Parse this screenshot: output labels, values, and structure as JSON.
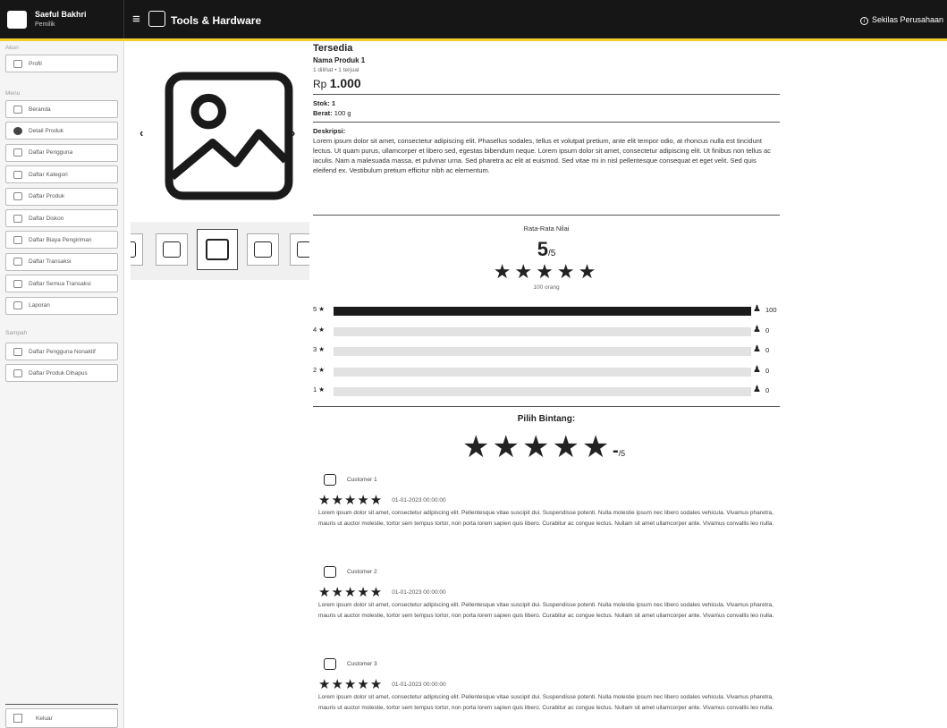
{
  "user": {
    "name": "Saeful Bakhri",
    "role": "Pemilik"
  },
  "header": {
    "category_title": "Tools & Hardware",
    "about_label": "Sekilas Perusahaan"
  },
  "sidebar": {
    "section_account": "Akun",
    "profile": "Profil",
    "section_menu": "Menu",
    "menu": [
      "Beranda",
      "Detail Produk",
      "Daftar Pengguna",
      "Daftar Kategori",
      "Daftar Produk",
      "Daftar Diskon",
      "Daftar Biaya Pengiriman",
      "Daftar Transaksi",
      "Daftar Semua Transaksi",
      "Laporan"
    ],
    "active_index": 1,
    "section_trash": "Sampah",
    "trash": [
      "Daftar Pengguna Nonaktif",
      "Daftar Produk Dihapus"
    ],
    "logout": "Keluar"
  },
  "product": {
    "status": "Tersedia",
    "name": "Nama Produk 1",
    "stats": "1 dilihat • 1 terjual",
    "currency": "Rp",
    "price": "1.000",
    "stock_label": "Stok:",
    "stock": "1",
    "weight_label": "Berat:",
    "weight": "100 g",
    "desc_label": "Deskripsi:",
    "description": "Lorem ipsum dolor sit amet, consectetur adipiscing elit. Phasellus sodales, tellus et volutpat pretium, ante elit tempor odio, at rhoncus nulla est tincidunt lectus. Ut quam purus, ullamcorper et libero sed, egestas bibendum neque. Lorem ipsum dolor sit amet, consectetur adipiscing elit. Ut finibus non tellus ac iaculis. Nam a malesuada massa, et pulvinar urna. Sed pharetra ac elit at euismod. Sed vitae mi in nisl pellentesque consequat et eget velit. Sed quis eleifend ex. Vestibulum pretium efficitur nibh ac elementum."
  },
  "gallery": {
    "prev": "‹",
    "next": "›"
  },
  "rating": {
    "label": "Rata-Rata Nilai",
    "value": "5",
    "max": "/5",
    "stars": "★★★★★",
    "count": "100 orang",
    "bars": [
      {
        "label": "5 ★",
        "count": "100",
        "fraction": 1
      },
      {
        "label": "4 ★",
        "count": "0",
        "fraction": 0
      },
      {
        "label": "3 ★",
        "count": "0",
        "fraction": 0
      },
      {
        "label": "2 ★",
        "count": "0",
        "fraction": 0
      },
      {
        "label": "1 ★",
        "count": "0",
        "fraction": 0
      }
    ]
  },
  "pick": {
    "label": "Pilih Bintang:",
    "stars": "★★★★★",
    "value": "-",
    "max": "/5"
  },
  "reviews": [
    {
      "name": "Customer 1",
      "stars": "★★★★★",
      "date": "01-01-2023 00:00:00",
      "text": "Lorem ipsum dolor sit amet, consectetur adipiscing elit. Pellentesque vitae suscipit dui. Suspendisse potenti. Nulla molestie ipsum nec libero sodales vehicula. Vivamus pharetra, mauris ut auctor molestie, tortor sem tempus tortor, non porta lorem sapien quis libero. Curabitur ac congue lectus. Nullam sit amet ullamcorper ante. Vivamus convallis leo nulla."
    },
    {
      "name": "Customer 2",
      "stars": "★★★★★",
      "date": "01-01-2023 00:00:00",
      "text": "Lorem ipsum dolor sit amet, consectetur adipiscing elit. Pellentesque vitae suscipit dui. Suspendisse potenti. Nulla molestie ipsum nec libero sodales vehicula. Vivamus pharetra, mauris ut auctor molestie, tortor sem tempus tortor, non porta lorem sapien quis libero. Curabitur ac congue lectus. Nullam sit amet ullamcorper ante. Vivamus convallis leo nulla."
    },
    {
      "name": "Customer 3",
      "stars": "★★★★★",
      "date": "01-01-2023 00:00:00",
      "text": "Lorem ipsum dolor sit amet, consectetur adipiscing elit. Pellentesque vitae suscipit dui. Suspendisse potenti. Nulla molestie ipsum nec libero sodales vehicula. Vivamus pharetra, mauris ut auctor molestie, tortor sem tempus tortor, non porta lorem sapien quis libero. Curabitur ac congue lectus. Nullam sit amet ullamcorper ante. Vivamus convallis leo nulla."
    }
  ]
}
